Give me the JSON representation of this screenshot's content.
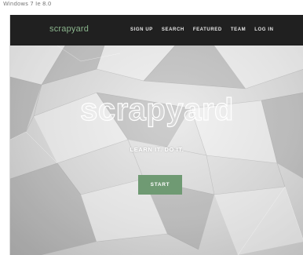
{
  "window": {
    "caption": "Windows 7 Ie 8.0"
  },
  "navbar": {
    "brand": "scrapyard",
    "links": [
      "SIGN UP",
      "SEARCH",
      "FEATURED",
      "TEAM",
      "LOG IN"
    ]
  },
  "hero": {
    "title": "scrapyard",
    "tagline": "LEARN IT. DO IT.",
    "start_label": "START"
  },
  "colors": {
    "navbar_background": "#202020",
    "brand": "#8ab48c",
    "start_button": "#6f9a73"
  }
}
